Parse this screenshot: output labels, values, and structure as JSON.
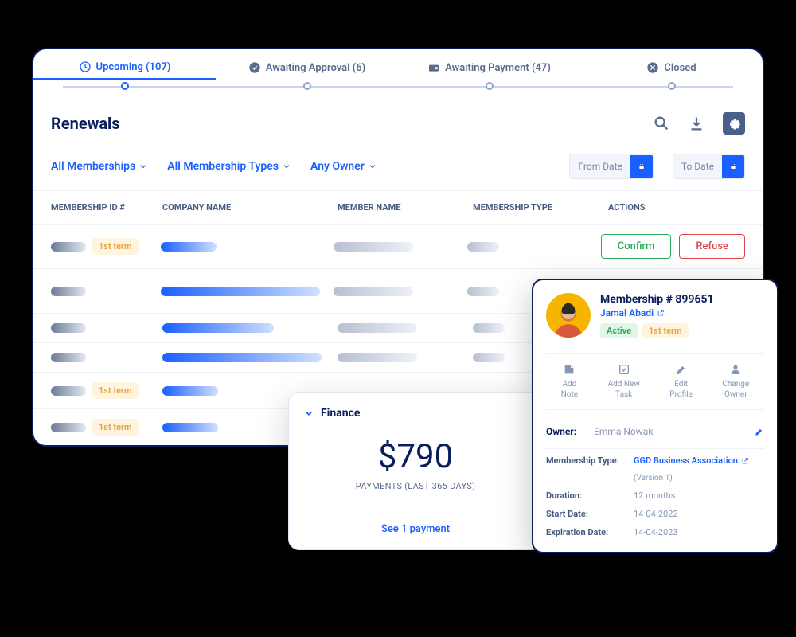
{
  "tabs": {
    "upcoming": "Upcoming (107)",
    "awaiting_approval": "Awaiting Approval (6)",
    "awaiting_payment": "Awaiting Payment (47)",
    "closed": "Closed"
  },
  "header": {
    "title": "Renewals"
  },
  "filters": {
    "memberships": "All Memberships",
    "types": "All Membership Types",
    "owner": "Any Owner",
    "from": "From Date",
    "to": "To Date"
  },
  "columns": {
    "id": "MEMBERSHIP ID #",
    "company": "COMPANY NAME",
    "member": "MEMBER NAME",
    "type": "MEMBERSHIP TYPE",
    "actions": "ACTIONS"
  },
  "row_badge": "1st term",
  "buttons": {
    "confirm": "Confirm",
    "refuse": "Refuse"
  },
  "finance": {
    "title": "Finance",
    "amount": "$790",
    "sub": "PAYMENTS (LAST 365 DAYS)",
    "link": "See 1 payment"
  },
  "side": {
    "title": "Membership # 899651",
    "member": "Jamal Abadi",
    "status": "Active",
    "term": "1st term",
    "actions": {
      "note": "Add\nNote",
      "task": "Add New\nTask",
      "edit": "Edit\nProfile",
      "owner": "Change\nOwner"
    },
    "owner_label": "Owner:",
    "owner": "Emma Nowak",
    "details": {
      "type_label": "Membership Type:",
      "type_value": "GGD Business Association",
      "type_version": "(Version 1)",
      "duration_label": "Duration:",
      "duration": "12 months",
      "start_label": "Start Date:",
      "start": "14-04-2022",
      "exp_label": "Expiration Date:",
      "exp": "14-04-2023"
    }
  }
}
